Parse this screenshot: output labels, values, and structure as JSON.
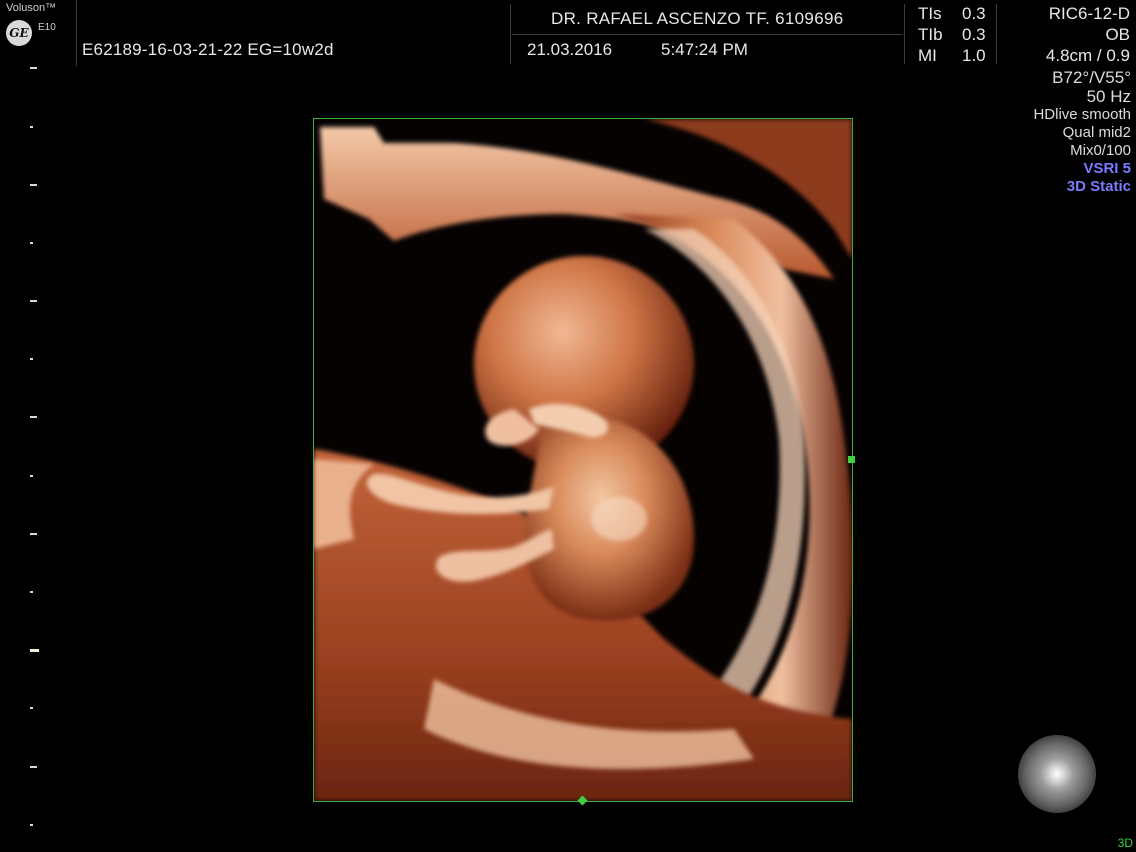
{
  "header": {
    "brand": "Voluson™",
    "logo_text": "GE",
    "model": "E10",
    "patient_line": "E62189-16-03-21-22  EG=10w2d",
    "doctor": "DR. RAFAEL ASCENZO TF. 6109696",
    "date": "21.03.2016",
    "time": "5:47:24 PM",
    "safety": [
      {
        "label": "TIs",
        "value": "0.3"
      },
      {
        "label": "TIb",
        "value": "0.3"
      },
      {
        "label": "MI",
        "value": "1.0"
      }
    ],
    "probe": "RIC6-12-D",
    "application": "OB",
    "depth": "4.8cm / 0.9"
  },
  "info_panel": {
    "angles": "B72°/V55°",
    "frequency": "50 Hz",
    "render_mode": "HDlive smooth",
    "quality": "Qual mid2",
    "mix": "Mix0/100",
    "vsri": "VSRI 5",
    "mode": "3D Static"
  },
  "render": {
    "type": "3D HDlive rendering of fetus (~10 weeks)",
    "roi_color": "#3fae3f"
  },
  "status": {
    "mode_indicator": "3D"
  },
  "colors": {
    "background": "#000000",
    "text": "#e8e8e8",
    "accent_blue": "#7a7aff",
    "roi_green": "#3fae3f",
    "tissue": "#c9683f"
  }
}
